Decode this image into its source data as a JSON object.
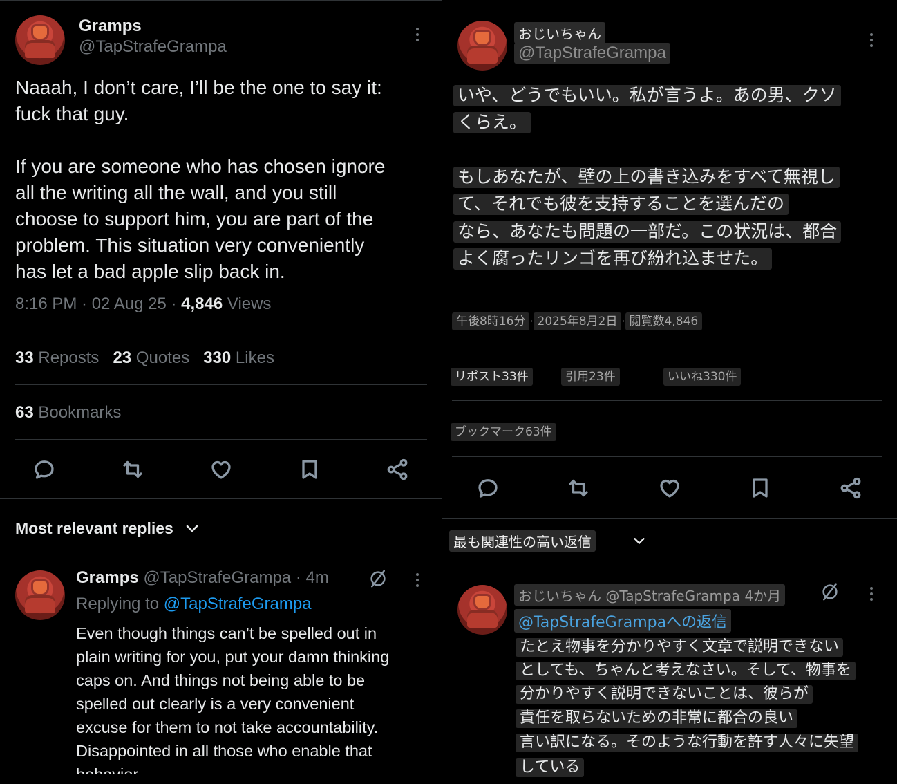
{
  "left": {
    "author": {
      "name": "Gramps",
      "handle": "@TapStrafeGrampa"
    },
    "tweet_text": "Naaah, I don’t care, I’ll be the one to say it:\nfuck that guy.\n\nIf you are someone who has chosen ignore\nall the writing all the wall, and you still\nchoose to support him, you are part of the\nproblem. This situation very conveniently\nhas let a bad apple slip back in.",
    "meta": {
      "time": "8:16 PM · 02 Aug 25 · ",
      "views_count": "4,846",
      "views_label": " Views"
    },
    "stats": {
      "reposts_count": "33",
      "reposts_label": " Reposts",
      "quotes_count": "23",
      "quotes_label": " Quotes",
      "likes_count": "330",
      "likes_label": " Likes",
      "bookmarks_count": "63",
      "bookmarks_label": " Bookmarks"
    },
    "replies_header": "Most relevant replies",
    "reply": {
      "name": "Gramps",
      "handle_time": " @TapStrafeGrampa · 4m",
      "replying_prefix": "Replying to ",
      "replying_handle": "@TapStrafeGrampa",
      "text": "Even though things can’t be spelled out in\nplain writing for you, put your damn thinking\ncaps on. And things not being able to be\nspelled out clearly is a very convenient\nexcuse for them to not take accountability.\nDisappointed in all those who enable that\nbehavior."
    }
  },
  "right": {
    "author": {
      "name": "おじいちゃん",
      "handle": "@TapStrafeGrampa"
    },
    "tweet_lines": [
      "いや、どうでもいい。私が言うよ。あの男、クソ",
      "くらえ。",
      "もしあなたが、壁の上の書き込みをすべて無視し",
      "て、それでも彼を支持することを選んだの",
      "なら、あなたも問題の一部だ。この状況は、都合",
      "よく腐ったリンゴを再び紛れ込ませた。"
    ],
    "meta": {
      "time": "午後8時16分",
      "date": "2025年8月2日",
      "views": "閲覧数4,846",
      "dot": "·"
    },
    "stats": {
      "reposts": "リポスト33件",
      "quotes": "引用23件",
      "likes": "いいね330件",
      "bookmarks": "ブックマーク63件"
    },
    "replies_header": "最も関連性の高い返信",
    "reply": {
      "header": "おじいちゃん @TapStrafeGrampa 4か月",
      "replying": "@TapStrafeGrampaへの返信",
      "lines": [
        "たとえ物事を分かりやすく文章で説明できない",
        "としても、ちゃんと考えなさい。そして、物事を",
        "分かりやすく説明できないことは、彼らが",
        "責任を取らないための非常に都合の良い",
        "言い訳になる。そのような行動を許す人々に失望",
        "している"
      ]
    }
  }
}
